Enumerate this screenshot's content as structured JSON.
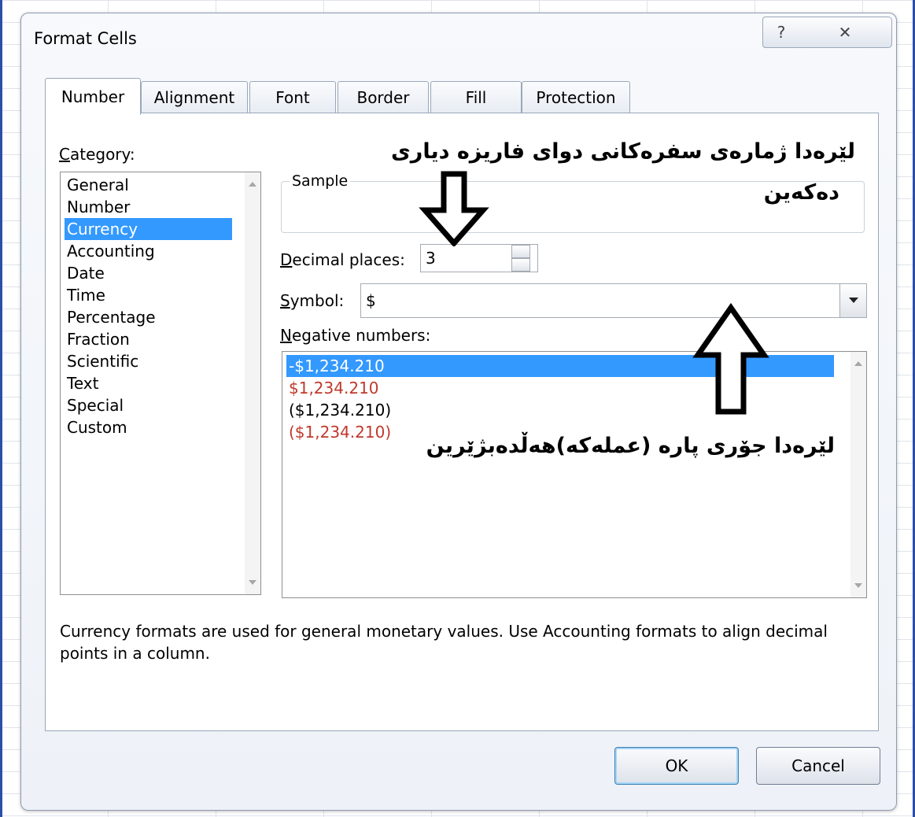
{
  "dialog": {
    "title": "Format Cells",
    "help_glyph": "?",
    "close_glyph": "✕"
  },
  "tabs": [
    {
      "label": "Number"
    },
    {
      "label": "Alignment"
    },
    {
      "label": "Font"
    },
    {
      "label": "Border"
    },
    {
      "label": "Fill"
    },
    {
      "label": "Protection"
    }
  ],
  "category": {
    "label_u": "C",
    "label_rest": "ategory:",
    "items": [
      "General",
      "Number",
      "Currency",
      "Accounting",
      "Date",
      "Time",
      "Percentage",
      "Fraction",
      "Scientific",
      "Text",
      "Special",
      "Custom"
    ],
    "selected": "Currency"
  },
  "sample": {
    "legend": "Sample",
    "value": ""
  },
  "decimal_places": {
    "label_u": "D",
    "label_rest": "ecimal places:",
    "value": "3"
  },
  "symbol": {
    "label_u": "S",
    "label_rest": "ymbol:",
    "value": "$"
  },
  "negative_numbers": {
    "label_u": "N",
    "label_rest": "egative numbers:",
    "items": [
      {
        "text": "-$1,234.210",
        "style": "selected"
      },
      {
        "text": "$1,234.210",
        "style": "red"
      },
      {
        "text": "($1,234.210)",
        "style": "black"
      },
      {
        "text": "($1,234.210)",
        "style": "red"
      }
    ]
  },
  "description": "Currency formats are used for general monetary values.  Use Accounting formats to align decimal points in a column.",
  "annotations": {
    "top_line1": "لێرەدا ژمارەی سفرەکانی دوای فاریزە دیاری",
    "top_line2": "دەکەین",
    "bottom": "لێرەدا جۆری پارە (عملەکە)هەڵدەبژێرین"
  },
  "buttons": {
    "ok": "OK",
    "cancel": "Cancel"
  },
  "colors": {
    "selection": "#3399ff",
    "negative_red": "#c0392b",
    "window_edge": "#2a4fa8"
  }
}
